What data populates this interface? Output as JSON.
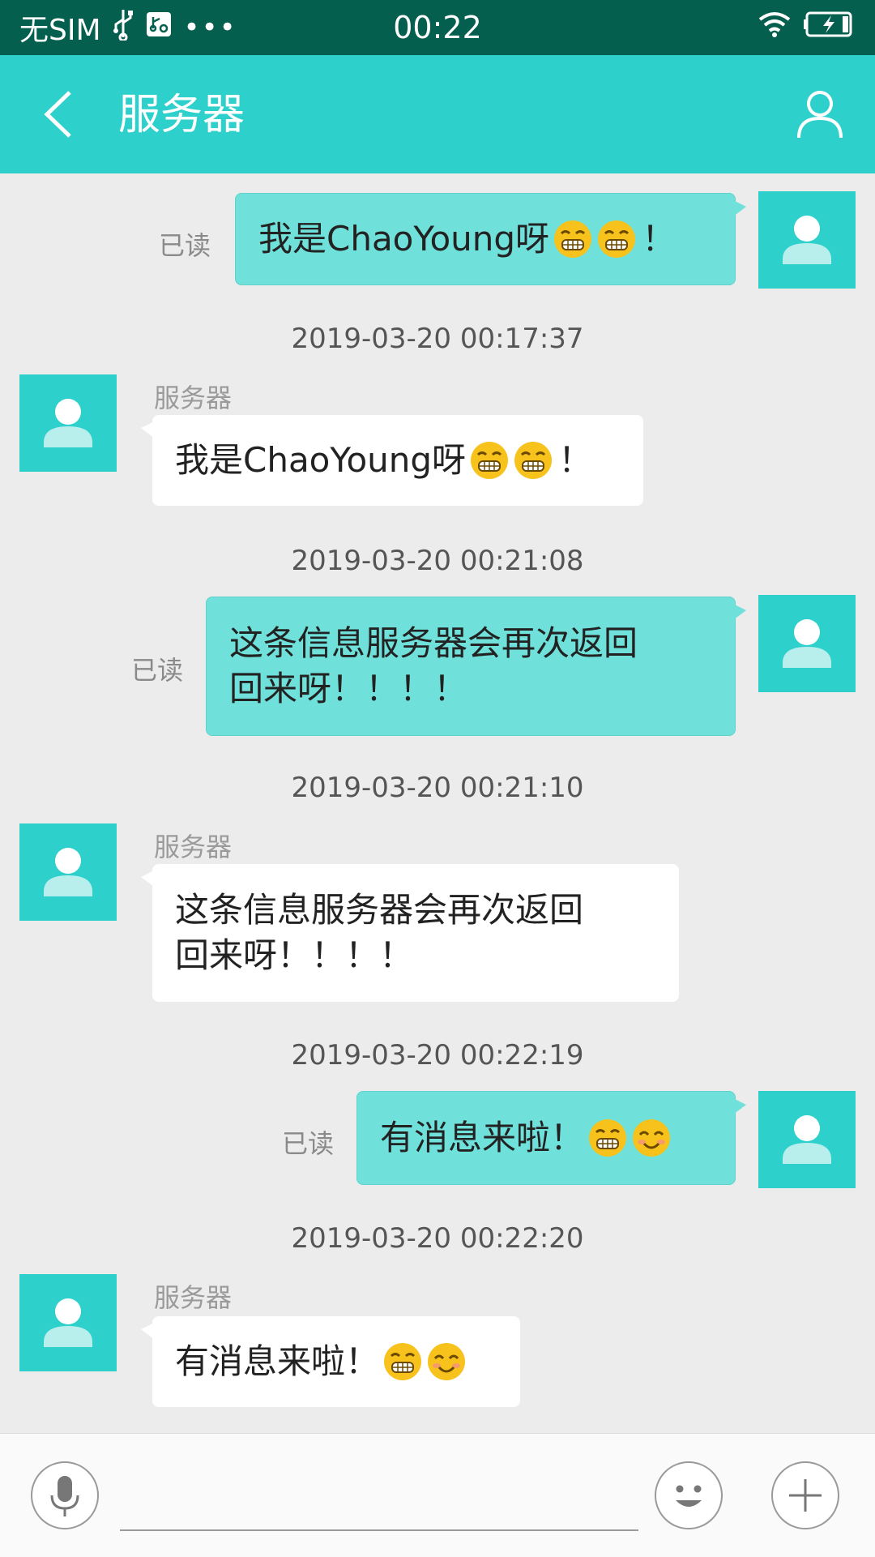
{
  "status_bar": {
    "carrier": "无SIM",
    "time": "00:22",
    "icons": [
      "usb-icon",
      "sd-card-icon",
      "more-dots-icon",
      "wifi-icon",
      "battery-charging-icon"
    ]
  },
  "app_bar": {
    "title": "服务器",
    "back_icon": "chevron-left-icon",
    "profile_icon": "person-outline-icon"
  },
  "messages": [
    {
      "direction": "out",
      "text": "我是ChaoYoung呀",
      "emojis": [
        "grin",
        "grin"
      ],
      "suffix": "！",
      "status": "已读"
    },
    {
      "direction": "in",
      "timestamp": "2019-03-20 00:17:37",
      "sender": "服务器",
      "text": "我是ChaoYoung呀",
      "emojis": [
        "grin",
        "grin"
      ],
      "suffix": "！"
    },
    {
      "direction": "out",
      "timestamp": "2019-03-20 00:21:08",
      "text_line1": "这条信息服务器会再次返回",
      "text_line2": "回来呀！！！！",
      "status": "已读"
    },
    {
      "direction": "in",
      "timestamp": "2019-03-20 00:21:10",
      "sender": "服务器",
      "text_line1": "这条信息服务器会再次返回",
      "text_line2": "回来呀！！！！"
    },
    {
      "direction": "out",
      "timestamp": "2019-03-20 00:22:19",
      "text": "有消息来啦！",
      "emojis": [
        "grin",
        "smile"
      ],
      "status": "已读"
    },
    {
      "direction": "in",
      "timestamp": "2019-03-20 00:22:20",
      "sender": "服务器",
      "text": "有消息来啦！",
      "emojis": [
        "grin",
        "smile"
      ]
    }
  ],
  "input_bar": {
    "placeholder": "",
    "value": "",
    "left_icon": "microphone-icon",
    "right_icons": [
      "emoji-icon",
      "plus-icon"
    ]
  },
  "colors": {
    "status_bar": "#055f4f",
    "accent": "#2ed0cc",
    "outgoing_bubble": "#70e0da",
    "incoming_bubble": "#ffffff",
    "background": "#ececec"
  }
}
